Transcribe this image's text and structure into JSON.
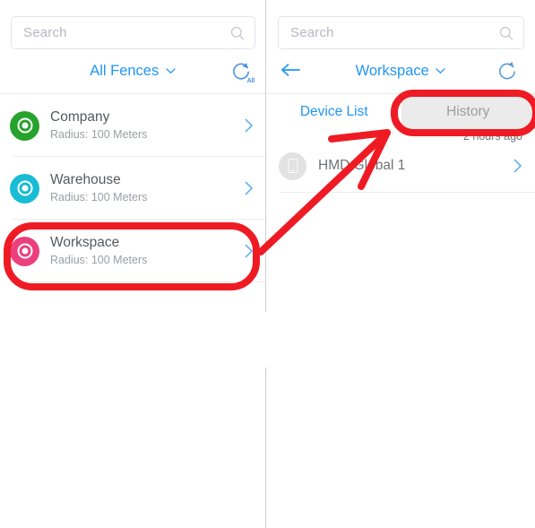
{
  "left_panel": {
    "search": {
      "placeholder": "Search",
      "value": "",
      "icon": "search-icon"
    },
    "header": {
      "title": "All Fences",
      "caret_icon": "chevron-down-icon",
      "refresh_icon": "refresh-all-icon",
      "refresh_label": "All"
    },
    "fences": [
      {
        "name": "Company",
        "radius": "Radius: 100 Meters",
        "color": "#27a22c",
        "icon": "geofence-target-icon",
        "chevron": "chevron-right-icon"
      },
      {
        "name": "Warehouse",
        "radius": "Radius: 100 Meters",
        "color": "#18bcd4",
        "icon": "geofence-target-icon",
        "chevron": "chevron-right-icon"
      },
      {
        "name": "Workspace",
        "radius": "Radius: 100 Meters",
        "color": "#ec3f7e",
        "icon": "geofence-target-icon",
        "chevron": "chevron-right-icon"
      }
    ]
  },
  "right_panel": {
    "search": {
      "placeholder": "Search",
      "value": "",
      "icon": "search-icon"
    },
    "header": {
      "back_icon": "arrow-left-icon",
      "title": "Workspace",
      "caret_icon": "chevron-down-icon",
      "refresh_icon": "refresh-icon"
    },
    "tabs": [
      {
        "label": "Device List",
        "state": "active"
      },
      {
        "label": "History",
        "state": "inactive"
      }
    ],
    "devices": [
      {
        "name": "HMD Global 1",
        "time": "2 hours ago",
        "icon": "phone-icon",
        "chevron": "chevron-right-icon"
      }
    ]
  },
  "annotations": {
    "color": "#ee1b24",
    "stroke_width": 8,
    "shapes": [
      {
        "name": "workspace-highlight-box",
        "type": "rounded-rect"
      },
      {
        "name": "history-tab-highlight-box",
        "type": "rounded-rect"
      },
      {
        "name": "pointer-arrow",
        "type": "arrow"
      }
    ]
  }
}
